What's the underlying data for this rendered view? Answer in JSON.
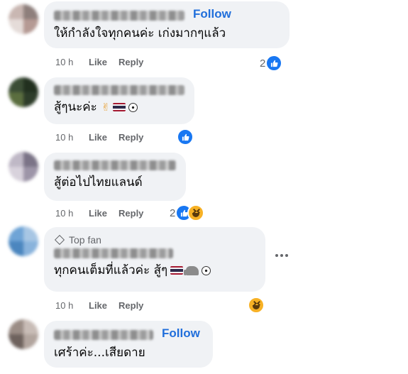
{
  "comments": [
    {
      "text": "ให้กำลังใจทุกคนค่ะ เก่งมากๆแล้ว",
      "follow_label": "Follow",
      "time": "10 h",
      "like_label": "Like",
      "reply_label": "Reply",
      "reaction_count": "2"
    },
    {
      "text": "สู้ๆนะค่ะ",
      "time": "10 h",
      "like_label": "Like",
      "reply_label": "Reply"
    },
    {
      "text": "สู้ต่อไปไทยแลนด์",
      "time": "10 h",
      "like_label": "Like",
      "reply_label": "Reply",
      "reaction_count": "2"
    },
    {
      "badge": "Top fan",
      "text": "ทุกคนเต็มที่แล้วค่ะ สู้ๆ",
      "time": "10 h",
      "like_label": "Like",
      "reply_label": "Reply"
    },
    {
      "text": "เศร้าค่ะ...เสียดาย",
      "follow_label": "Follow"
    }
  ],
  "colors": {
    "bubble": "#f0f2f5",
    "follow": "#216fdb",
    "meta": "#65676b",
    "like_blue": "#1877f2",
    "haha_yellow": "#f7b125"
  },
  "icons": [
    "like-reaction-icon",
    "haha-reaction-icon",
    "more-options-icon",
    "top-fan-diamond-icon",
    "victory-hand-emoji",
    "thailand-flag-emoji",
    "soccer-ball-emoji",
    "elephant-emoji"
  ]
}
